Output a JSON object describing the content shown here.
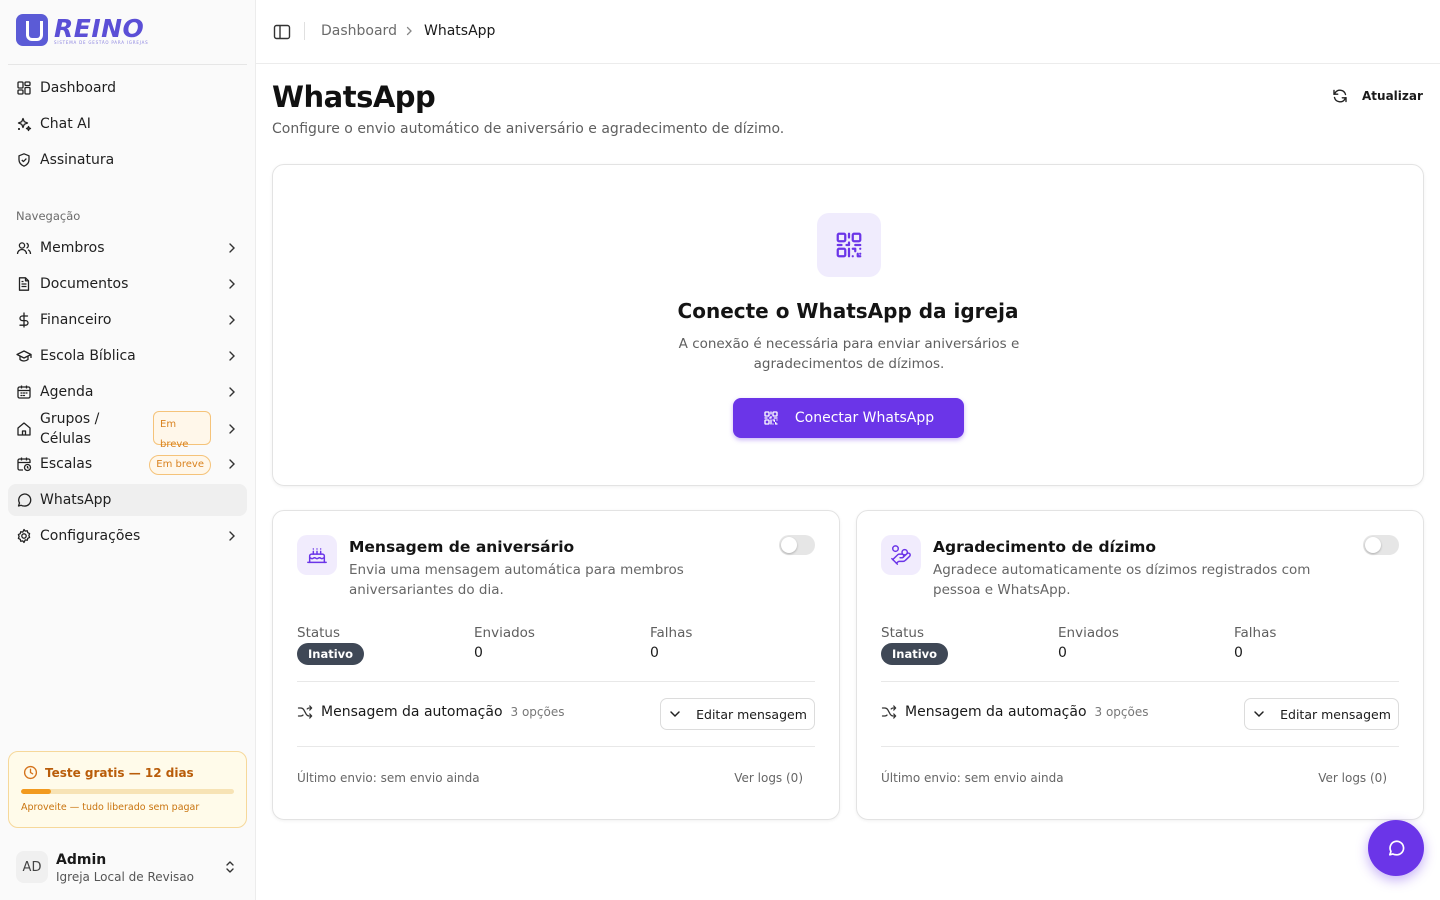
{
  "brand": {
    "name": "REINO",
    "tagline": "SISTEMA DE GESTÃO PARA IGREJAS"
  },
  "sidebar": {
    "top_items": [
      {
        "label": "Dashboard",
        "icon": "dashboard-grid-icon"
      },
      {
        "label": "Chat AI",
        "icon": "sparkles-icon"
      },
      {
        "label": "Assinatura",
        "icon": "shield-check-icon"
      }
    ],
    "section_label": "Navegação",
    "items": [
      {
        "label": "Membros",
        "icon": "users-icon"
      },
      {
        "label": "Documentos",
        "icon": "document-icon"
      },
      {
        "label": "Financeiro",
        "icon": "dollar-icon"
      },
      {
        "label": "Escola Bíblica",
        "icon": "graduation-cap-icon"
      },
      {
        "label": "Agenda",
        "icon": "calendar-icon"
      },
      {
        "label": "Grupos / Células",
        "icon": "home-icon",
        "badge": "Em breve"
      },
      {
        "label": "Escalas",
        "icon": "calendar-clock-icon",
        "badge": "Em breve"
      },
      {
        "label": "WhatsApp",
        "icon": "message-circle-icon",
        "active": true
      },
      {
        "label": "Configurações",
        "icon": "settings-icon"
      }
    ],
    "trial": {
      "title": "Teste gratis — 12 dias",
      "subtitle": "Aproveite — tudo liberado sem pagar",
      "progress": 0.14
    },
    "user": {
      "initials": "AD",
      "name": "Admin",
      "org": "Igreja Local de Revisao"
    }
  },
  "breadcrumb": {
    "parent": "Dashboard",
    "current": "WhatsApp"
  },
  "page": {
    "title": "WhatsApp",
    "subtitle": "Configure o envio automático de aniversário e agradecimento de dízimo.",
    "refresh_label": "Atualizar"
  },
  "connect": {
    "title": "Conecte o WhatsApp da igreja",
    "description": "A conexão é necessária para enviar aniversários e agradecimentos de dízimos.",
    "button_label": "Conectar WhatsApp"
  },
  "automations": [
    {
      "title": "Mensagem de aniversário",
      "description": "Envia uma mensagem automática para membros aniversariantes do dia.",
      "enabled": false,
      "status_label": "Status",
      "status_value": "Inativo",
      "sent_label": "Enviados",
      "sent_value": "0",
      "fail_label": "Falhas",
      "fail_value": "0",
      "message_label": "Mensagem da automação",
      "options": "3 opções",
      "edit_label": "Editar mensagem",
      "last_send": "Último envio: sem envio ainda",
      "logs_label": "Ver logs (0)"
    },
    {
      "title": "Agradecimento de dízimo",
      "description": "Agradece automaticamente os dízimos registrados com pessoa e WhatsApp.",
      "enabled": false,
      "status_label": "Status",
      "status_value": "Inativo",
      "sent_label": "Enviados",
      "sent_value": "0",
      "fail_label": "Falhas",
      "fail_value": "0",
      "message_label": "Mensagem da automação",
      "options": "3 opções",
      "edit_label": "Editar mensagem",
      "last_send": "Último envio: sem envio ainda",
      "logs_label": "Ver logs (0)"
    }
  ],
  "colors": {
    "accent": "#6b35e8",
    "brand": "#5b4fd6",
    "trial_accent": "#f29a1f",
    "status_inactive": "#3f4856"
  }
}
